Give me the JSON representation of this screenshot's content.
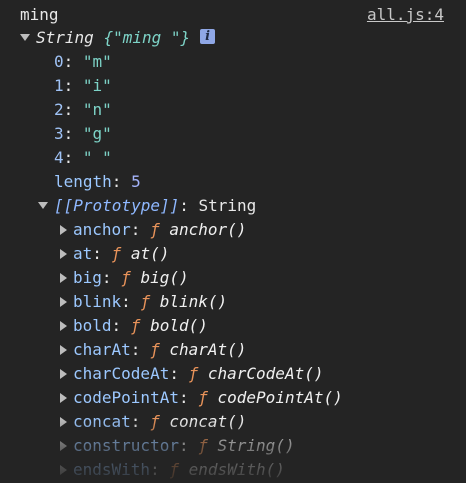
{
  "log": {
    "message": "ming",
    "source": "all.js:4"
  },
  "object": {
    "type_label": "String",
    "preview": "{\"ming \"}",
    "info_icon": "info-icon",
    "entries": [
      {
        "key": "0",
        "value": "\"m\""
      },
      {
        "key": "1",
        "value": "\"i\""
      },
      {
        "key": "2",
        "value": "\"n\""
      },
      {
        "key": "3",
        "value": "\"g\""
      },
      {
        "key": "4",
        "value": "\" \""
      }
    ],
    "length_key": "length",
    "length_value": "5",
    "prototype_label": "[[Prototype]]",
    "prototype_value": "String",
    "methods": [
      {
        "key": "anchor",
        "sym": "ƒ",
        "fn": "anchor()"
      },
      {
        "key": "at",
        "sym": "ƒ",
        "fn": "at()"
      },
      {
        "key": "big",
        "sym": "ƒ",
        "fn": "big()"
      },
      {
        "key": "blink",
        "sym": "ƒ",
        "fn": "blink()"
      },
      {
        "key": "bold",
        "sym": "ƒ",
        "fn": "bold()"
      },
      {
        "key": "charAt",
        "sym": "ƒ",
        "fn": "charAt()"
      },
      {
        "key": "charCodeAt",
        "sym": "ƒ",
        "fn": "charCodeAt()"
      },
      {
        "key": "codePointAt",
        "sym": "ƒ",
        "fn": "codePointAt()"
      },
      {
        "key": "concat",
        "sym": "ƒ",
        "fn": "concat()"
      },
      {
        "key": "constructor",
        "sym": "ƒ",
        "fn": "String()"
      },
      {
        "key": "endsWith",
        "sym": "ƒ",
        "fn": "endsWith()"
      }
    ]
  },
  "colors": {
    "background": "#242424",
    "string": "#7dd3c7",
    "key": "#9cc8ff",
    "function_symbol": "#e8935a"
  }
}
